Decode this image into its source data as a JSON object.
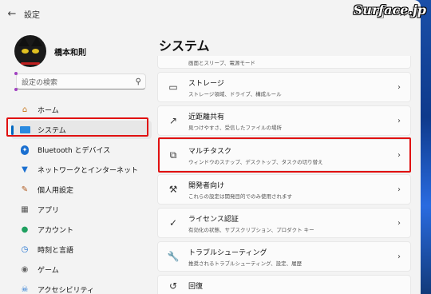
{
  "window": {
    "app_title": "設定",
    "back_icon": "back-arrow-icon"
  },
  "watermark": "Surface.jp",
  "profile": {
    "name": "橋本和則"
  },
  "search": {
    "placeholder": "設定の検索"
  },
  "nav": {
    "items": [
      {
        "label": "ホーム",
        "icon": "home-icon"
      },
      {
        "label": "システム",
        "icon": "system-icon"
      },
      {
        "label": "Bluetooth とデバイス",
        "icon": "bluetooth-icon"
      },
      {
        "label": "ネットワークとインターネット",
        "icon": "wifi-icon"
      },
      {
        "label": "個人用設定",
        "icon": "brush-icon"
      },
      {
        "label": "アプリ",
        "icon": "apps-icon"
      },
      {
        "label": "アカウント",
        "icon": "account-icon"
      },
      {
        "label": "時刻と言語",
        "icon": "clock-icon"
      },
      {
        "label": "ゲーム",
        "icon": "gamepad-icon"
      },
      {
        "label": "アクセシビリティ",
        "icon": "accessibility-icon"
      }
    ],
    "active_index": 1
  },
  "main": {
    "title": "システム",
    "rows": [
      {
        "title": "",
        "subtitle": "画面とスリープ、電源モード",
        "icon": "power-icon"
      },
      {
        "title": "ストレージ",
        "subtitle": "ストレージ領域、ドライブ、構成ルール",
        "icon": "storage-icon"
      },
      {
        "title": "近距離共有",
        "subtitle": "見つけやすさ、受信したファイルの場所",
        "icon": "share-icon"
      },
      {
        "title": "マルチタスク",
        "subtitle": "ウィンドウのスナップ、デスクトップ、タスクの切り替え",
        "icon": "multitask-icon"
      },
      {
        "title": "開発者向け",
        "subtitle": "これらの設定は開発目的でのみ使用されます",
        "icon": "developer-icon"
      },
      {
        "title": "ライセンス認証",
        "subtitle": "有効化の状態、サブスクリプション、プロダクト キー",
        "icon": "activation-icon"
      },
      {
        "title": "トラブルシューティング",
        "subtitle": "推奨されるトラブルシューティング、設定、履歴",
        "icon": "wrench-icon"
      },
      {
        "title": "回復",
        "subtitle": "",
        "icon": "recovery-icon"
      }
    ]
  },
  "colors": {
    "accent": "#0067c0",
    "highlight_box": "#e01010"
  }
}
